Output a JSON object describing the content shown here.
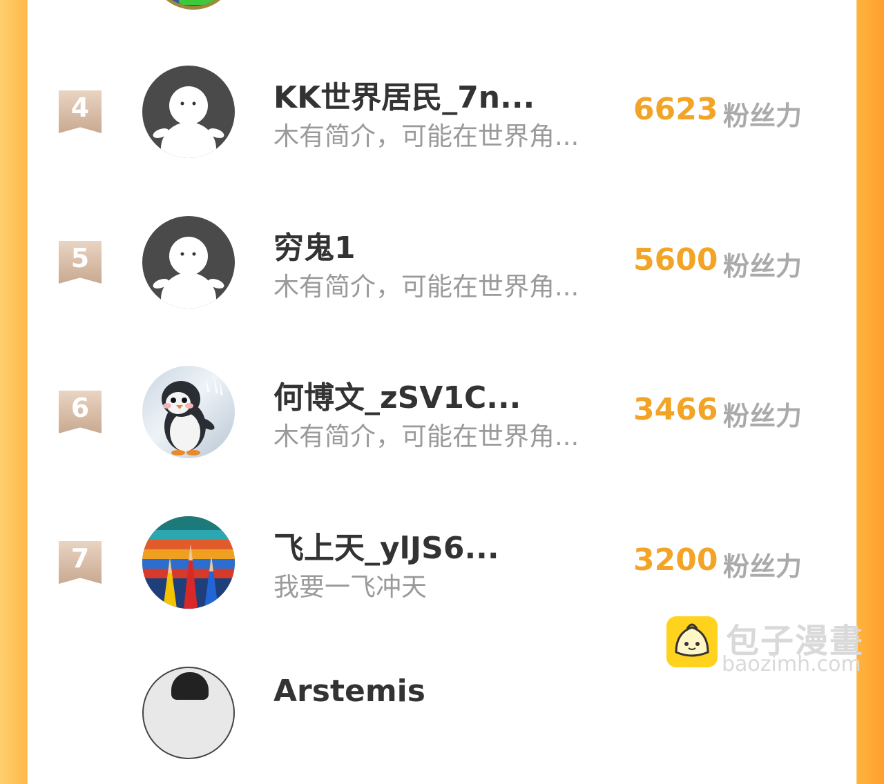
{
  "ranking": {
    "unit_label": "粉丝力",
    "entries": [
      {
        "rank": "4",
        "name": "KK世界居民_7n...",
        "bio": "木有简介，可能在世界角...",
        "score": "6623",
        "avatar": "default-avatar"
      },
      {
        "rank": "5",
        "name": "穷鬼1",
        "bio": "木有简介，可能在世界角...",
        "score": "5600",
        "avatar": "default-avatar"
      },
      {
        "rank": "6",
        "name": "何博文_zSV1C...",
        "bio": "木有简介，可能在世界角...",
        "score": "3466",
        "avatar": "penguin-photo"
      },
      {
        "rank": "7",
        "name": "飞上天_ylJS6...",
        "bio": "我要一飞冲天",
        "score": "3200",
        "avatar": "colored-pencils-photo"
      },
      {
        "rank": "",
        "name": "Arstemis",
        "bio": "",
        "score": "",
        "avatar": "person-photo"
      }
    ]
  },
  "watermark": {
    "title": "包子漫畫",
    "url": "baozimh.com"
  },
  "colors": {
    "accent": "#f2a427",
    "border_orange": "#ffb33f",
    "rank_badge": "#d6b9a2",
    "watermark_logo": "#ffd21e"
  }
}
